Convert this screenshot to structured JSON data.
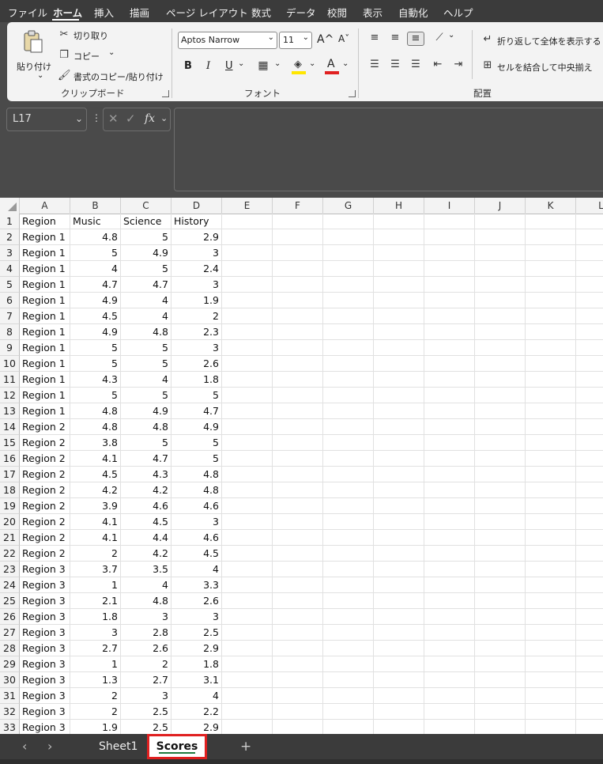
{
  "menu": [
    "ファイル",
    "ホーム",
    "挿入",
    "描画",
    "ページ レイアウト",
    "数式",
    "データ",
    "校閲",
    "表示",
    "自動化",
    "ヘルプ"
  ],
  "ribbon": {
    "paste": "貼り付け",
    "cut": "切り取り",
    "copy": "コピー",
    "format_painter": "書式のコピー/貼り付け",
    "clipboard_group": "クリップボード",
    "font_name": "Aptos Narrow",
    "font_size": "11",
    "font_group": "フォント",
    "wrap_text": "折り返して全体を表示する",
    "merge_center": "セルを結合して中央揃え",
    "alignment_group": "配置",
    "bold": "B",
    "italic": "I",
    "underline": "U",
    "font_color_glyph": "A",
    "grow_font": "A^",
    "shrink_font": "Aˇ"
  },
  "formula_bar": {
    "name_box": "L17",
    "fx": "fx",
    "formula": ""
  },
  "columns": [
    "A",
    "B",
    "C",
    "D",
    "E",
    "F",
    "G",
    "H",
    "I",
    "J",
    "K",
    "L"
  ],
  "sheet": {
    "rows": [
      [
        "Region",
        "Music",
        "Science",
        "History"
      ],
      [
        "Region 1",
        "4.8",
        "5",
        "2.9"
      ],
      [
        "Region 1",
        "5",
        "4.9",
        "3"
      ],
      [
        "Region 1",
        "4",
        "5",
        "2.4"
      ],
      [
        "Region 1",
        "4.7",
        "4.7",
        "3"
      ],
      [
        "Region 1",
        "4.9",
        "4",
        "1.9"
      ],
      [
        "Region 1",
        "4.5",
        "4",
        "2"
      ],
      [
        "Region 1",
        "4.9",
        "4.8",
        "2.3"
      ],
      [
        "Region 1",
        "5",
        "5",
        "3"
      ],
      [
        "Region 1",
        "5",
        "5",
        "2.6"
      ],
      [
        "Region 1",
        "4.3",
        "4",
        "1.8"
      ],
      [
        "Region 1",
        "5",
        "5",
        "5"
      ],
      [
        "Region 1",
        "4.8",
        "4.9",
        "4.7"
      ],
      [
        "Region 2",
        "4.8",
        "4.8",
        "4.9"
      ],
      [
        "Region 2",
        "3.8",
        "5",
        "5"
      ],
      [
        "Region 2",
        "4.1",
        "4.7",
        "5"
      ],
      [
        "Region 2",
        "4.5",
        "4.3",
        "4.8"
      ],
      [
        "Region 2",
        "4.2",
        "4.2",
        "4.8"
      ],
      [
        "Region 2",
        "3.9",
        "4.6",
        "4.6"
      ],
      [
        "Region 2",
        "4.1",
        "4.5",
        "3"
      ],
      [
        "Region 2",
        "4.1",
        "4.4",
        "4.6"
      ],
      [
        "Region 2",
        "2",
        "4.2",
        "4.5"
      ],
      [
        "Region 3",
        "3.7",
        "3.5",
        "4"
      ],
      [
        "Region 3",
        "1",
        "4",
        "3.3"
      ],
      [
        "Region 3",
        "2.1",
        "4.8",
        "2.6"
      ],
      [
        "Region 3",
        "1.8",
        "3",
        "3"
      ],
      [
        "Region 3",
        "3",
        "2.8",
        "2.5"
      ],
      [
        "Region 3",
        "2.7",
        "2.6",
        "2.9"
      ],
      [
        "Region 3",
        "1",
        "2",
        "1.8"
      ],
      [
        "Region 3",
        "1.3",
        "2.7",
        "3.1"
      ],
      [
        "Region 3",
        "2",
        "3",
        "4"
      ],
      [
        "Region 3",
        "2",
        "2.5",
        "2.2"
      ],
      [
        "Region 3",
        "1.9",
        "2.5",
        "2.9"
      ]
    ]
  },
  "tabs": {
    "sheet1": "Sheet1",
    "scores": "Scores",
    "add": "+"
  },
  "colors": {
    "highlight": "#e02020",
    "fill_color": "#ffe600",
    "font_color": "#e02020"
  }
}
